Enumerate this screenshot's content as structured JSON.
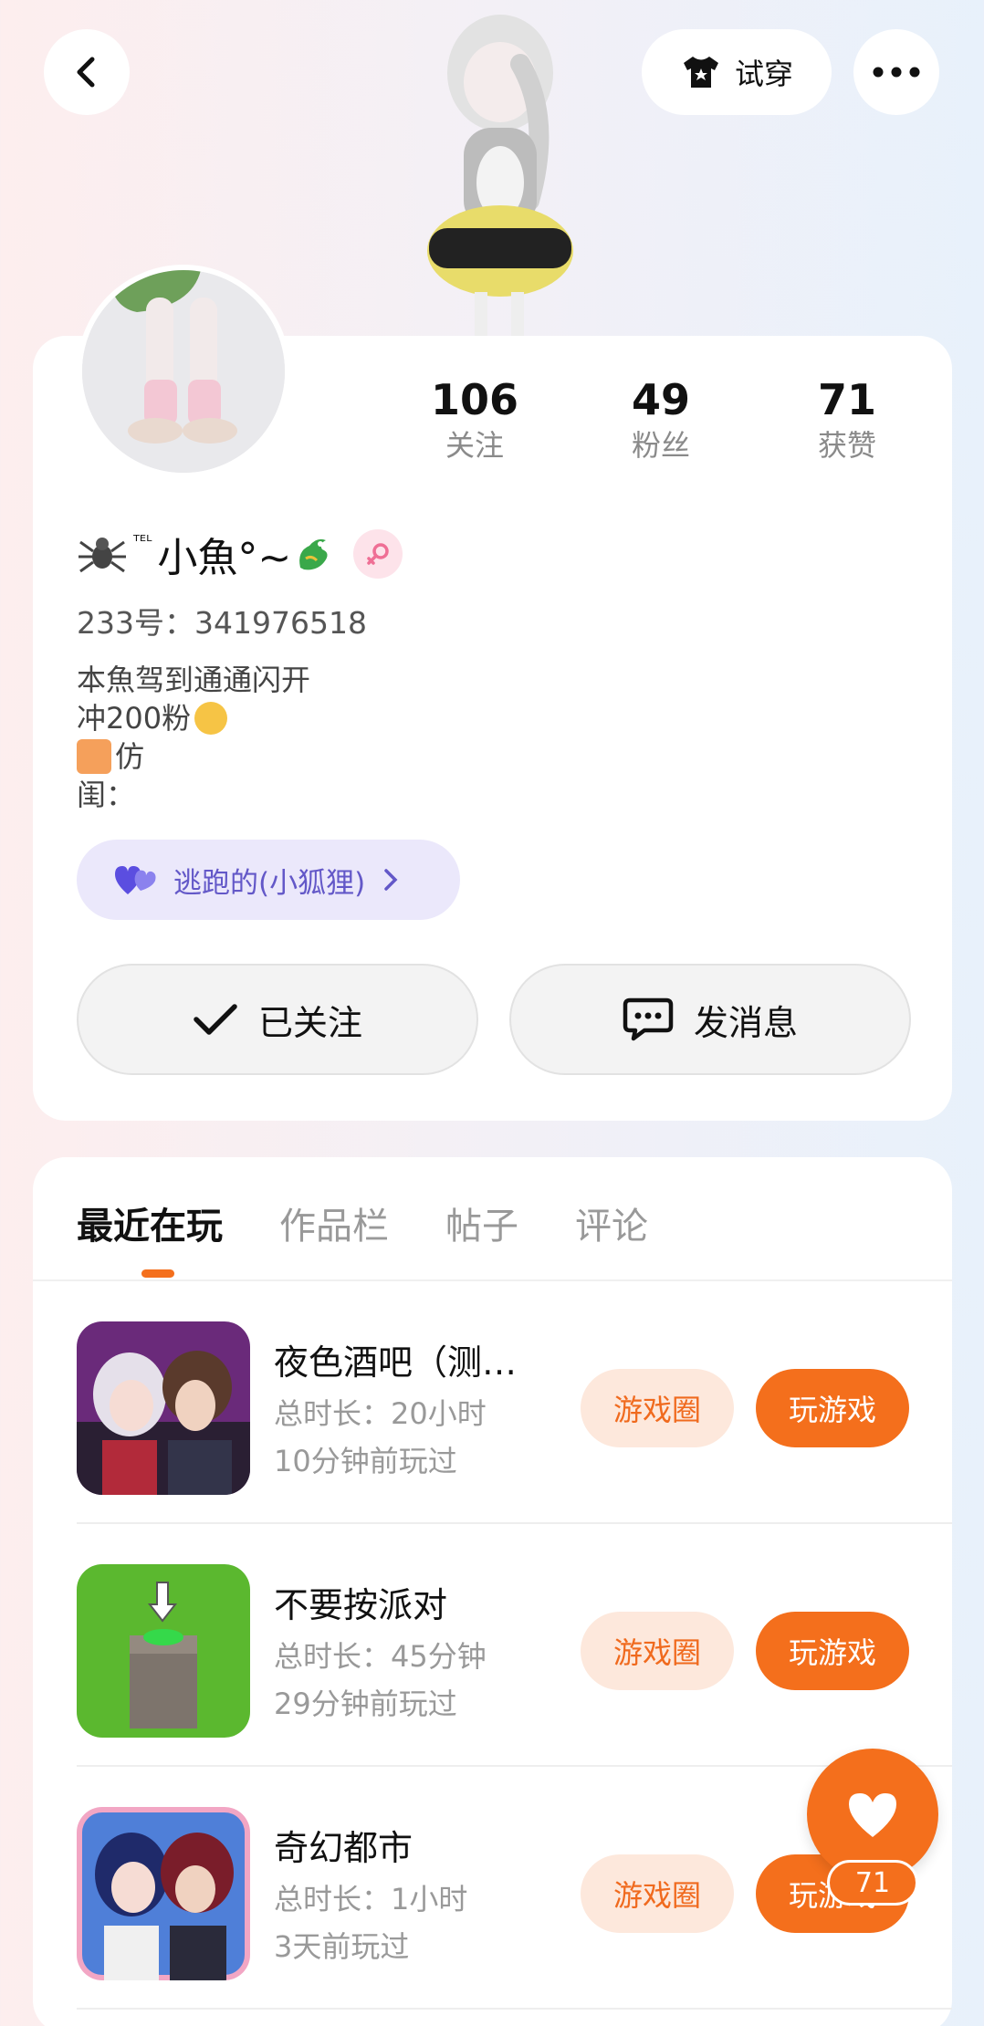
{
  "header": {
    "tryon_label": "试穿",
    "icons": {
      "back": "chevron-left-icon",
      "tryon": "tshirt-icon",
      "more": "more-icon"
    }
  },
  "profile": {
    "stats": [
      {
        "value": "106",
        "label": "关注"
      },
      {
        "value": "49",
        "label": "粉丝"
      },
      {
        "value": "71",
        "label": "获赞"
      }
    ],
    "nickname_prefix": "ᵀᴱᴸ",
    "nickname": "小魚°~",
    "uid": "233号：341976518",
    "bio": [
      "本魚驾到通通闪开",
      "冲200粉",
      "仿",
      "闺："
    ],
    "tag_label": "逃跑的(小狐狸)",
    "follow_label": "已关注",
    "message_label": "发消息"
  },
  "tabs": [
    {
      "label": "最近在玩",
      "active": true
    },
    {
      "label": "作品栏",
      "active": false
    },
    {
      "label": "帖子",
      "active": false
    },
    {
      "label": "评论",
      "active": false
    }
  ],
  "games": [
    {
      "name": "夜色酒吧（测…",
      "duration": "总时长：20小时",
      "last_played": "10分钟前玩过",
      "circle_label": "游戏圈",
      "play_label": "玩游戏"
    },
    {
      "name": "不要按派对",
      "duration": "总时长：45分钟",
      "last_played": "29分钟前玩过",
      "circle_label": "游戏圈",
      "play_label": "玩游戏"
    },
    {
      "name": "奇幻都市",
      "duration": "总时长：1小时",
      "last_played": "3天前玩过",
      "circle_label": "游戏圈",
      "play_label": "玩游戏"
    }
  ],
  "like_fab": {
    "count": "71"
  },
  "colors": {
    "accent": "#f46f1c",
    "accent_soft": "#fde8dc",
    "tag_bg": "#ebe8fb",
    "tag_text": "#6358c8"
  }
}
